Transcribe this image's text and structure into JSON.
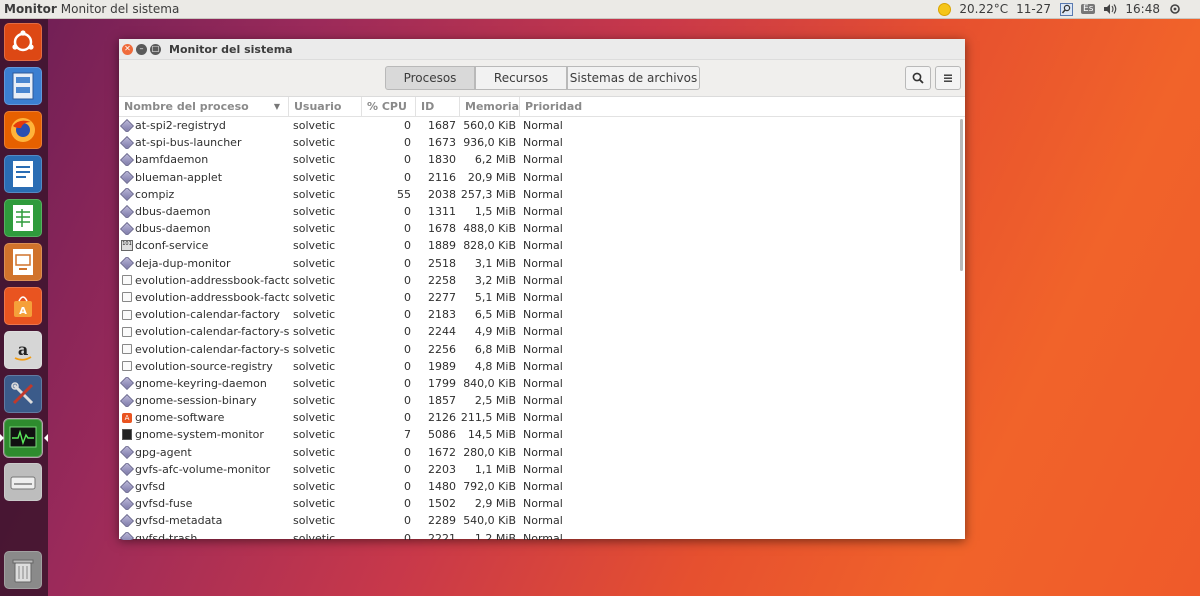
{
  "top_panel": {
    "app_name": "Monitor",
    "window_title": "Monitor del sistema",
    "temperature": "20.22°C",
    "date": "11-27",
    "keyboard": "Es",
    "time": "16:48"
  },
  "launcher": {
    "items": [
      {
        "name": "ubuntu-dash",
        "icon": "ubuntu-logo-icon",
        "color": "#dd4814"
      },
      {
        "name": "files",
        "icon": "file-cabinet-icon",
        "color": "#3b7fd1"
      },
      {
        "name": "firefox",
        "icon": "firefox-icon",
        "color": "#e66000"
      },
      {
        "name": "libreoffice-writer",
        "icon": "writer-icon",
        "color": "#2a6db4"
      },
      {
        "name": "libreoffice-calc",
        "icon": "calc-icon",
        "color": "#2f9b3c"
      },
      {
        "name": "libreoffice-impress",
        "icon": "impress-icon",
        "color": "#d1732c"
      },
      {
        "name": "ubuntu-software",
        "icon": "software-center-icon",
        "color": "#e95420"
      },
      {
        "name": "amazon",
        "icon": "amazon-icon",
        "color": "#c7c7c7"
      },
      {
        "name": "system-settings",
        "icon": "tools-icon",
        "color": "#3b5b8a"
      },
      {
        "name": "system-monitor",
        "icon": "system-monitor-icon",
        "color": "#3aa83a"
      },
      {
        "name": "drive",
        "icon": "drive-icon",
        "color": "#bdbdbd"
      },
      {
        "name": "trash",
        "icon": "trash-icon",
        "color": "#9a9a9a"
      }
    ]
  },
  "window": {
    "title": "Monitor del sistema",
    "tabs": [
      {
        "label": "Procesos",
        "active": true
      },
      {
        "label": "Recursos",
        "active": false
      },
      {
        "label": "Sistemas de archivos",
        "active": false
      }
    ],
    "columns": {
      "name": "Nombre del proceso",
      "user": "Usuario",
      "cpu": "% CPU",
      "id": "ID",
      "memory": "Memoria",
      "priority": "Prioridad"
    },
    "processes": [
      {
        "icon": "diamond",
        "name": "at-spi2-registryd",
        "user": "solvetic",
        "cpu": "0",
        "id": "1687",
        "mem": "560,0 KiB",
        "pri": "Normal"
      },
      {
        "icon": "diamond",
        "name": "at-spi-bus-launcher",
        "user": "solvetic",
        "cpu": "0",
        "id": "1673",
        "mem": "936,0 KiB",
        "pri": "Normal"
      },
      {
        "icon": "diamond",
        "name": "bamfdaemon",
        "user": "solvetic",
        "cpu": "0",
        "id": "1830",
        "mem": "6,2 MiB",
        "pri": "Normal"
      },
      {
        "icon": "diamond",
        "name": "blueman-applet",
        "user": "solvetic",
        "cpu": "0",
        "id": "2116",
        "mem": "20,9 MiB",
        "pri": "Normal"
      },
      {
        "icon": "diamond",
        "name": "compiz",
        "user": "solvetic",
        "cpu": "55",
        "id": "2038",
        "mem": "257,3 MiB",
        "pri": "Normal"
      },
      {
        "icon": "diamond",
        "name": "dbus-daemon",
        "user": "solvetic",
        "cpu": "0",
        "id": "1311",
        "mem": "1,5 MiB",
        "pri": "Normal"
      },
      {
        "icon": "diamond",
        "name": "dbus-daemon",
        "user": "solvetic",
        "cpu": "0",
        "id": "1678",
        "mem": "488,0 KiB",
        "pri": "Normal"
      },
      {
        "icon": "dconf",
        "name": "dconf-service",
        "user": "solvetic",
        "cpu": "0",
        "id": "1889",
        "mem": "828,0 KiB",
        "pri": "Normal"
      },
      {
        "icon": "diamond",
        "name": "deja-dup-monitor",
        "user": "solvetic",
        "cpu": "0",
        "id": "2518",
        "mem": "3,1 MiB",
        "pri": "Normal"
      },
      {
        "icon": "env",
        "name": "evolution-addressbook-factor",
        "user": "solvetic",
        "cpu": "0",
        "id": "2258",
        "mem": "3,2 MiB",
        "pri": "Normal"
      },
      {
        "icon": "env",
        "name": "evolution-addressbook-factor",
        "user": "solvetic",
        "cpu": "0",
        "id": "2277",
        "mem": "5,1 MiB",
        "pri": "Normal"
      },
      {
        "icon": "env",
        "name": "evolution-calendar-factory",
        "user": "solvetic",
        "cpu": "0",
        "id": "2183",
        "mem": "6,5 MiB",
        "pri": "Normal"
      },
      {
        "icon": "env",
        "name": "evolution-calendar-factory-su",
        "user": "solvetic",
        "cpu": "0",
        "id": "2244",
        "mem": "4,9 MiB",
        "pri": "Normal"
      },
      {
        "icon": "env",
        "name": "evolution-calendar-factory-su",
        "user": "solvetic",
        "cpu": "0",
        "id": "2256",
        "mem": "6,8 MiB",
        "pri": "Normal"
      },
      {
        "icon": "env",
        "name": "evolution-source-registry",
        "user": "solvetic",
        "cpu": "0",
        "id": "1989",
        "mem": "4,8 MiB",
        "pri": "Normal"
      },
      {
        "icon": "diamond",
        "name": "gnome-keyring-daemon",
        "user": "solvetic",
        "cpu": "0",
        "id": "1799",
        "mem": "840,0 KiB",
        "pri": "Normal"
      },
      {
        "icon": "diamond",
        "name": "gnome-session-binary",
        "user": "solvetic",
        "cpu": "0",
        "id": "1857",
        "mem": "2,5 MiB",
        "pri": "Normal"
      },
      {
        "icon": "soft",
        "name": "gnome-software",
        "user": "solvetic",
        "cpu": "0",
        "id": "2126",
        "mem": "211,5 MiB",
        "pri": "Normal"
      },
      {
        "icon": "mon",
        "name": "gnome-system-monitor",
        "user": "solvetic",
        "cpu": "7",
        "id": "5086",
        "mem": "14,5 MiB",
        "pri": "Normal"
      },
      {
        "icon": "diamond",
        "name": "gpg-agent",
        "user": "solvetic",
        "cpu": "0",
        "id": "1672",
        "mem": "280,0 KiB",
        "pri": "Normal"
      },
      {
        "icon": "diamond",
        "name": "gvfs-afc-volume-monitor",
        "user": "solvetic",
        "cpu": "0",
        "id": "2203",
        "mem": "1,1 MiB",
        "pri": "Normal"
      },
      {
        "icon": "diamond",
        "name": "gvfsd",
        "user": "solvetic",
        "cpu": "0",
        "id": "1480",
        "mem": "792,0 KiB",
        "pri": "Normal"
      },
      {
        "icon": "diamond",
        "name": "gvfsd-fuse",
        "user": "solvetic",
        "cpu": "0",
        "id": "1502",
        "mem": "2,9 MiB",
        "pri": "Normal"
      },
      {
        "icon": "diamond",
        "name": "gvfsd-metadata",
        "user": "solvetic",
        "cpu": "0",
        "id": "2289",
        "mem": "540,0 KiB",
        "pri": "Normal"
      },
      {
        "icon": "diamond",
        "name": "gvfsd-trash",
        "user": "solvetic",
        "cpu": "0",
        "id": "2221",
        "mem": "1,2 MiB",
        "pri": "Normal"
      }
    ]
  }
}
